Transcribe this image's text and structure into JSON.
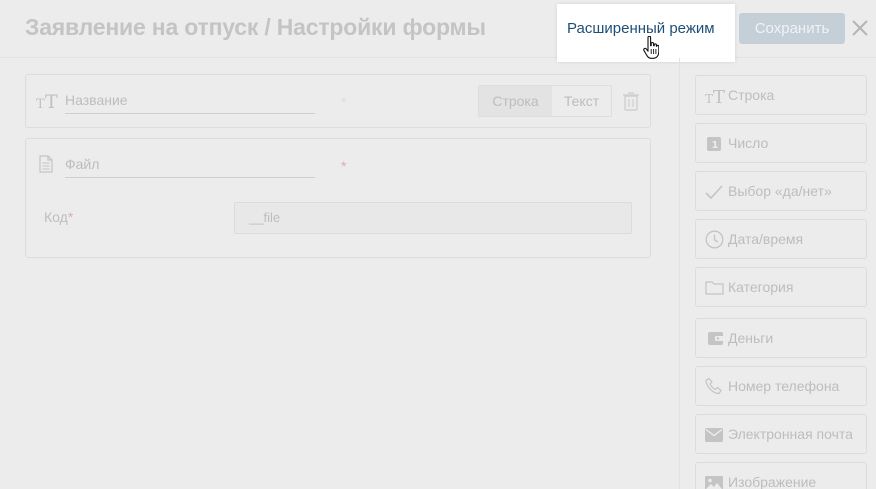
{
  "header": {
    "title": "Заявление на отпуск / Настройки формы",
    "advanced_mode_label": "Расширенный режим",
    "save_label": "Сохранить"
  },
  "fields": [
    {
      "label": "Название",
      "type_options": [
        "Строка",
        "Текст"
      ],
      "selected_type": "Строка",
      "icon": "text-type-icon"
    },
    {
      "label": "Файл",
      "icon": "document-icon",
      "code_label": "Код",
      "code_required_mark": "*",
      "code_value": "__file"
    }
  ],
  "required_mark": "*",
  "sidebar": {
    "items": [
      {
        "label": "Строка",
        "icon": "text-type-icon"
      },
      {
        "label": "Число",
        "icon": "number-icon"
      },
      {
        "label": "Выбор «да/нет»",
        "icon": "check-icon"
      },
      {
        "label": "Дата/время",
        "icon": "clock-icon"
      },
      {
        "label": "Категория",
        "icon": "folder-icon"
      },
      {
        "label": "Деньги",
        "icon": "wallet-icon"
      },
      {
        "label": "Номер телефона",
        "icon": "phone-icon"
      },
      {
        "label": "Электронная почта",
        "icon": "mail-icon"
      },
      {
        "label": "Изображение",
        "icon": "image-icon"
      }
    ]
  },
  "colors": {
    "accent": "#1f4f77",
    "save_button": "#c5cfd8",
    "required": "#e8a9a9",
    "background": "#ececec"
  }
}
